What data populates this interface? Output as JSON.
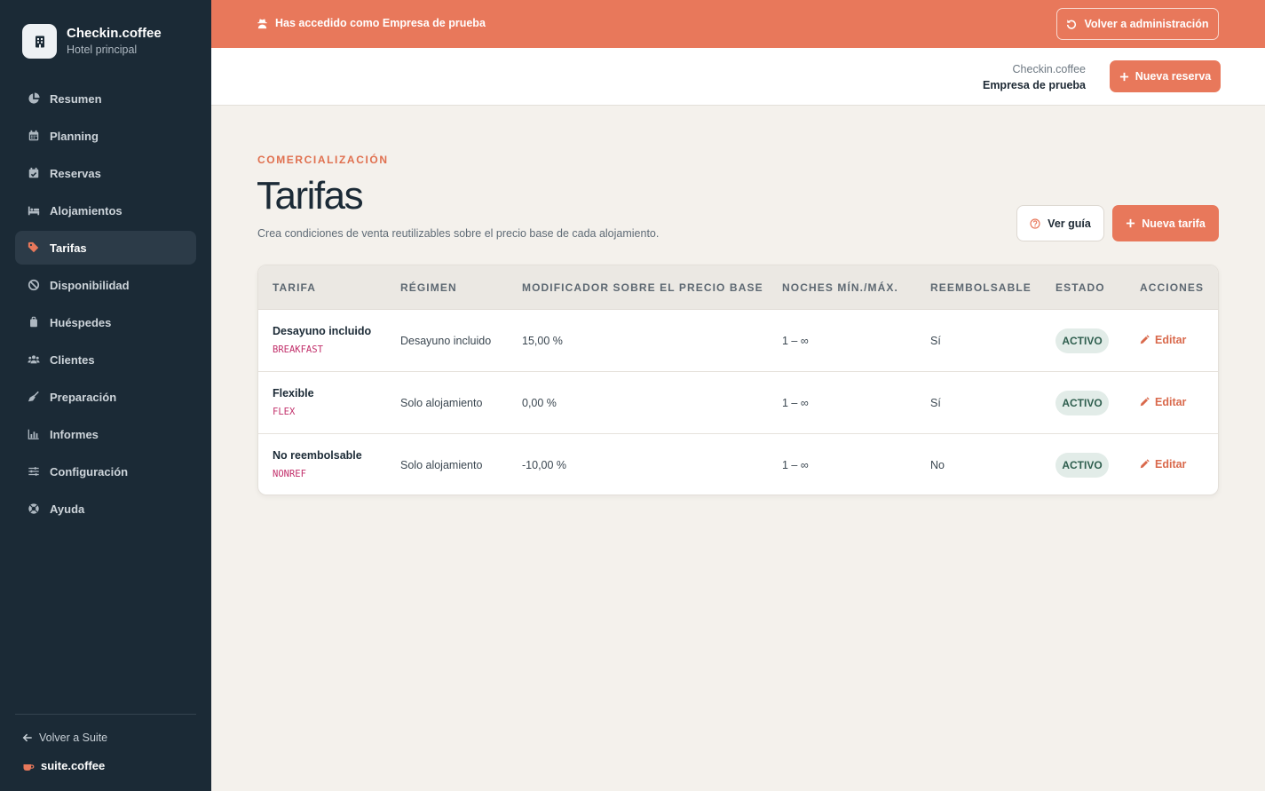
{
  "sidebar": {
    "brand_name": "Checkin.coffee",
    "brand_sub": "Hotel principal",
    "items": [
      {
        "label": "Resumen",
        "icon": "chart-pie-icon"
      },
      {
        "label": "Planning",
        "icon": "calendar-icon"
      },
      {
        "label": "Reservas",
        "icon": "calendar-check-icon"
      },
      {
        "label": "Alojamientos",
        "icon": "bed-icon"
      },
      {
        "label": "Tarifas",
        "icon": "tags-icon"
      },
      {
        "label": "Disponibilidad",
        "icon": "ban-icon"
      },
      {
        "label": "Huéspedes",
        "icon": "suitcase-icon"
      },
      {
        "label": "Clientes",
        "icon": "users-icon"
      },
      {
        "label": "Preparación",
        "icon": "broom-icon"
      },
      {
        "label": "Informes",
        "icon": "bar-chart-icon"
      },
      {
        "label": "Configuración",
        "icon": "sliders-icon"
      },
      {
        "label": "Ayuda",
        "icon": "lifebuoy-icon"
      }
    ],
    "active_item": "Tarifas",
    "back_label": "Volver a Suite",
    "suite_label": "suite.coffee"
  },
  "banner": {
    "message": "Has accedido como Empresa de prueba",
    "button_label": "Volver a administración"
  },
  "header": {
    "org": "Checkin.coffee",
    "company": "Empresa de prueba",
    "new_booking_label": "Nueva reserva"
  },
  "page": {
    "eyebrow": "COMERCIALIZACIÓN",
    "title": "Tarifas",
    "description": "Crea condiciones de venta reutilizables sobre el precio base de cada alojamiento.",
    "guide_label": "Ver guía",
    "new_rate_label": "Nueva tarifa"
  },
  "table": {
    "headers": [
      "TARIFA",
      "RÉGIMEN",
      "MODIFICADOR SOBRE EL PRECIO BASE",
      "NOCHES MÍN./MÁX.",
      "REEMBOLSABLE",
      "ESTADO",
      "ACCIONES"
    ],
    "rows": [
      {
        "name": "Desayuno incluido",
        "code": "BREAKFAST",
        "regimen": "Desayuno incluido",
        "modifier": "15,00 %",
        "nights": "1 – ∞",
        "refundable": "Sí",
        "status": "ACTIVO",
        "action": "Editar"
      },
      {
        "name": "Flexible",
        "code": "FLEX",
        "regimen": "Solo alojamiento",
        "modifier": "0,00 %",
        "nights": "1 – ∞",
        "refundable": "Sí",
        "status": "ACTIVO",
        "action": "Editar"
      },
      {
        "name": "No reembolsable",
        "code": "NONREF",
        "regimen": "Solo alojamiento",
        "modifier": "-10,00 %",
        "nights": "1 – ∞",
        "refundable": "No",
        "status": "ACTIVO",
        "action": "Editar"
      }
    ]
  },
  "colors": {
    "accent": "#e8785b",
    "sidebar_bg": "#1b2a36",
    "page_bg": "#f4f1ec",
    "badge_bg": "#e2ece8",
    "code_color": "#c2306b"
  }
}
